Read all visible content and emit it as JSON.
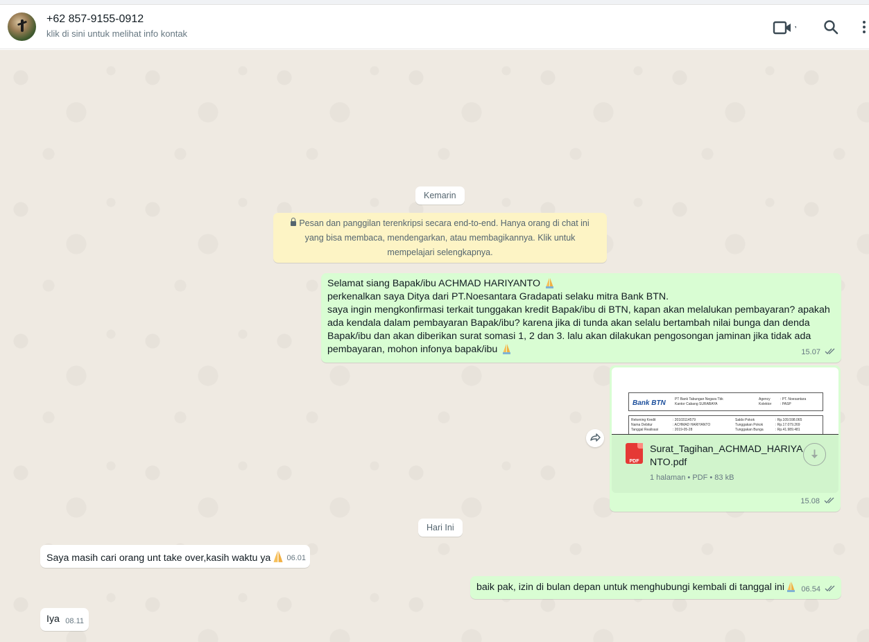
{
  "header": {
    "contact_name": "+62 857-9155-0912",
    "contact_subtitle": "klik di sini untuk melihat info kontak"
  },
  "date_dividers": {
    "yesterday": "Kemarin",
    "today": "Hari Ini"
  },
  "encryption_notice": {
    "line1": "Pesan dan panggilan terenkripsi secara end-to-end. Hanya orang di chat ini",
    "line2": "yang bisa membaca, mendengarkan, atau membagikannya. Klik untuk",
    "line3": "mempelajari selengkapnya."
  },
  "messages": {
    "m1": {
      "lines": [
        "Selamat siang Bapak/ibu  ACHMAD HARIYANTO",
        "perkenalkan saya Ditya dari PT.Noesantara Gradapati selaku mitra Bank BTN.",
        "saya ingin mengkonfirmasi terkait tunggakan kredit Bapak/ibu di BTN, kapan akan melalukan pembayaran? apakah",
        "ada kendala dalam pembayaran Bapak/ibu? karena jika di tunda akan selalu bertambah nilai bunga dan denda",
        "Bapak/ibu dan akan diberikan surat somasi 1, 2 dan 3. lalu akan dilakukan pengosongan jaminan jika tidak ada",
        "pembayaran, mohon infonya bapak/ibu"
      ],
      "time": "15.07"
    },
    "m_pdf": {
      "file_name": "Surat_Tagihan_ACHMAD_HARIYANTO.pdf",
      "file_info": "1 halaman • PDF • 83 kB",
      "icon_label": "PDF",
      "time": "15.08",
      "preview": {
        "logo": "Bank BTN",
        "bank_line1": "PT Bank Tabungan Negara Tbk",
        "bank_line2": "Kantor Cabang SURABAYA",
        "agency_label": "Agency",
        "agency_value": ": PT. Noesantara",
        "kolektor_label": "Kolektor",
        "kolektor_value": ": PASP",
        "r1_label": "Rekening Kredit",
        "r1_value": ": 20103114579",
        "r2_label": "Nama Debitur",
        "r2_value": ": ACHMAD HARIYANTO",
        "r3_label": "Tanggal Realisasi",
        "r3_value": ": 2019-05-28",
        "s1_label": "Saldo Pokok",
        "s1_value": ": Rp.109.598.065",
        "s2_label": "Tunggakan Pokok",
        "s2_value": ": Rp.17.079.269",
        "s3_label": "Tunggakan Bunga",
        "s3_value": ": Rp.41.989.481"
      }
    },
    "m2": {
      "text": "Saya masih cari orang unt take over,kasih waktu ya",
      "time": "06.01"
    },
    "m3": {
      "text": "baik pak, izin di bulan depan untuk menghubungi kembali di tanggal ini",
      "time": "06.54"
    },
    "m4": {
      "text": "Iya",
      "time": "08.11"
    }
  },
  "colors": {
    "outgoing_bubble": "#d9fdd3",
    "incoming_bubble": "#ffffff",
    "chat_background": "#efeae2",
    "read_ticks": "#8696a0",
    "notice_background": "#fdf4c5"
  },
  "icons": {
    "video_call": "video-camera-icon",
    "search": "search-icon",
    "menu": "kebab-menu-icon",
    "lock": "lock-icon",
    "pdf": "pdf-file-icon",
    "download": "download-icon",
    "forward": "forward-icon",
    "emoji": "folded-hands-emoji"
  }
}
